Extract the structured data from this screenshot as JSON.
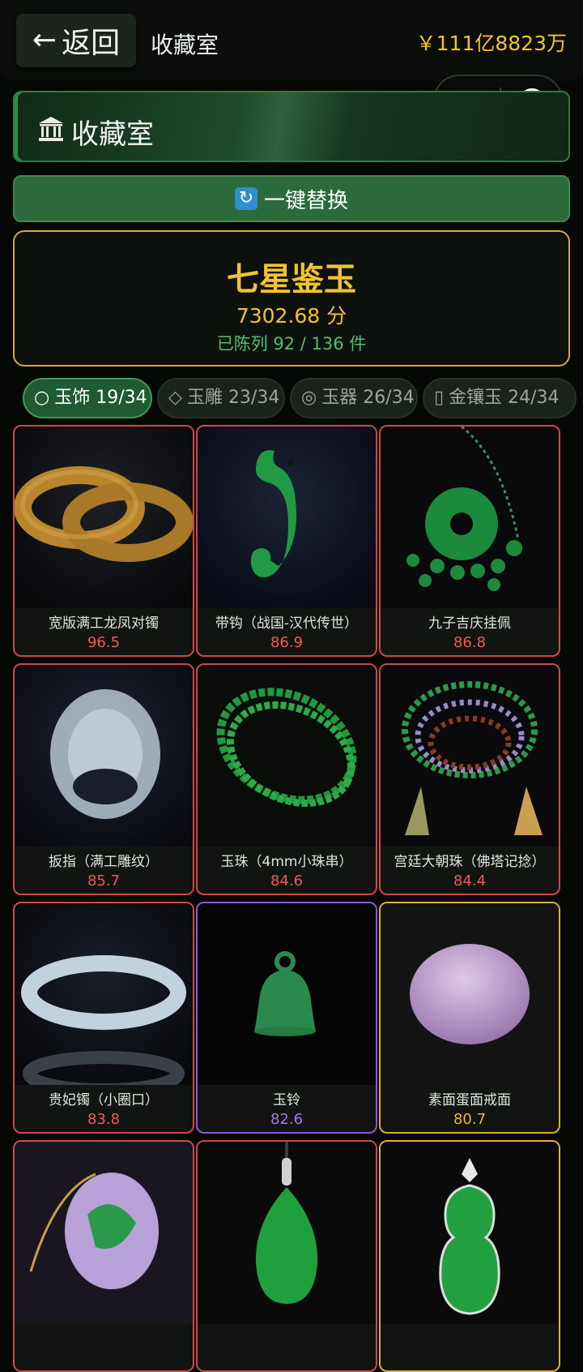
{
  "header": {
    "back_label": "返回",
    "back_icon": "left-arrow-icon",
    "title": "收藏室",
    "balance": "￥111亿8823万"
  },
  "banner": {
    "icon": "museum-icon",
    "title": "收藏室"
  },
  "replace_button": {
    "icon": "refresh-icon",
    "label": "一键替换"
  },
  "summary": {
    "title": "七星鉴玉",
    "score": "7302.68 分",
    "exhibited": "已陈列 92 / 136 件"
  },
  "tabs": [
    {
      "glyph": "○",
      "label": "玉饰 19/34",
      "active": true
    },
    {
      "glyph": "◇",
      "label": "玉雕 23/34",
      "active": false
    },
    {
      "glyph": "◎",
      "label": "玉器 26/34",
      "active": false
    },
    {
      "glyph": "▯",
      "label": "金镶玉 24/34",
      "active": false
    }
  ],
  "items": [
    {
      "name": "宽版满工龙凤对镯",
      "score": "96.5",
      "rarity": "red"
    },
    {
      "name": "带钩（战国-汉代传世）",
      "score": "86.9",
      "rarity": "red"
    },
    {
      "name": "九子吉庆挂佩",
      "score": "86.8",
      "rarity": "red"
    },
    {
      "name": "扳指（满工雕纹）",
      "score": "85.7",
      "rarity": "red"
    },
    {
      "name": "玉珠（4mm小珠串）",
      "score": "84.6",
      "rarity": "red"
    },
    {
      "name": "宫廷大朝珠（佛塔记捻）",
      "score": "84.4",
      "rarity": "red"
    },
    {
      "name": "贵妃镯（小圈口）",
      "score": "83.8",
      "rarity": "red"
    },
    {
      "name": "玉铃",
      "score": "82.6",
      "rarity": "purple"
    },
    {
      "name": "素面蛋面戒面",
      "score": "80.7",
      "rarity": "gold"
    },
    {
      "name": "",
      "score": "",
      "rarity": "red"
    },
    {
      "name": "",
      "score": "",
      "rarity": "red"
    },
    {
      "name": "",
      "score": "",
      "rarity": "gold"
    }
  ],
  "colors": {
    "gold": "#f2c232",
    "green_accent": "#2c6a3c",
    "rarity_red": "#d04848",
    "rarity_purple": "#8a58d8",
    "rarity_gold": "#d8b03a"
  }
}
